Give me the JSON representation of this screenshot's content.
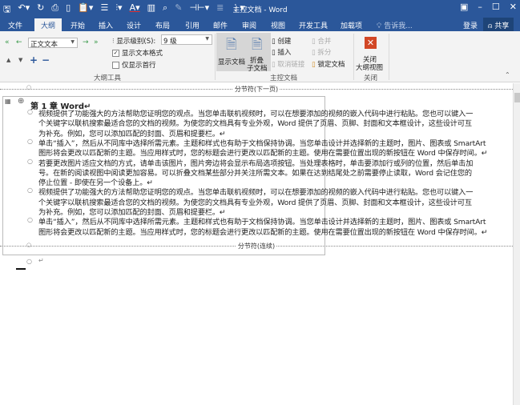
{
  "window": {
    "title": "主控文档 - Word",
    "qat_icons": [
      "save-icon",
      "undo-icon",
      "redo-icon",
      "print-preview-icon",
      "new-icon",
      "paste-icon",
      "outline-icon",
      "align-icon",
      "font-color-icon",
      "columns-icon",
      "find-icon",
      "pen-icon",
      "margins-icon",
      "list-icon",
      "more-icon"
    ]
  },
  "tabs": [
    {
      "label": "文件"
    },
    {
      "label": "大纲"
    },
    {
      "label": "开始"
    },
    {
      "label": "插入"
    },
    {
      "label": "设计"
    },
    {
      "label": "布局"
    },
    {
      "label": "引用"
    },
    {
      "label": "邮件"
    },
    {
      "label": "审阅"
    },
    {
      "label": "视图"
    },
    {
      "label": "开发工具"
    },
    {
      "label": "加载项"
    }
  ],
  "tell_me": "告诉我...",
  "login": "登录",
  "share": "共享",
  "outline_tools": {
    "level_value": "正文文本",
    "show_level_label": "显示级别(S):",
    "show_level_value": "9 级",
    "show_format": "显示文本格式",
    "first_line_only": "仅显示首行",
    "group_label": "大纲工具",
    "show_format_checked": true,
    "first_line_checked": false
  },
  "master_doc": {
    "show_doc": "显示文档",
    "collapse_line1": "折叠",
    "collapse_line2": "子文档",
    "create": "创建",
    "insert": "插入",
    "unlink": "取消链接",
    "merge": "合并",
    "split": "拆分",
    "lock": "锁定文档",
    "group_label": "主控文档"
  },
  "close": {
    "line1": "关闭",
    "line2": "大纲视图",
    "group_label": "关闭"
  },
  "document": {
    "break_top": "分节符(下一页)",
    "break_bottom": "分节符(连续)",
    "heading": "第 1 章 Word↵",
    "paragraphs": [
      [
        "视频提供了功能强大的方法帮助您证明您的观点。当您单击联机视频时，可以在想要添加的视频的嵌入代码中进行粘贴。您也可以键入一",
        "个关键字以联机搜索最适合您的文档的视频。为使您的文档具有专业外观，Word 提供了页眉、页脚、封面和文本框设计，这些设计可互",
        "为补充。例如，您可以添加匹配的封面、页眉和提要栏。↵"
      ],
      [
        "单击“插入”，然后从不同库中选择所需元素。主题和样式也有助于文档保持协调。当您单击设计并选择新的主题时，图片、图表或 SmartArt",
        "图形将会更改以匹配新的主题。当应用样式时，您的标题会进行更改以匹配新的主题。使用在需要位置出现的新按钮在 Word 中保存时间。↵"
      ],
      [
        "若要更改图片适应文档的方式，请单击该图片，图片旁边将会显示布局选项按钮。当处理表格时，单击要添加行或列的位置，然后单击加",
        "号。在新的阅读视图中阅读更加容易。可以折叠文档某些部分并关注所需文本。如果在达到结尾处之前需要停止读取，Word 会记住您的",
        "停止位置 - 即使在另一个设备上。↵"
      ],
      [
        "视频提供了功能强大的方法帮助您证明您的观点。当您单击联机视频时，可以在想要添加的视频的嵌入代码中进行粘贴。您也可以键入一",
        "个关键字以联机搜索最适合您的文档的视频。为使您的文档具有专业外观，Word 提供了页眉、页脚、封面和文本框设计，这些设计可互",
        "为补充。例如，您可以添加匹配的封面、页眉和提要栏。↵"
      ],
      [
        "单击“插入”，然后从不同库中选择所需元素。主题和样式也有助于文档保持协调。当您单击设计并选择新的主题时，图片、图表或 SmartArt",
        "图形将会更改以匹配新的主题。当应用样式时，您的标题会进行更改以匹配新的主题。使用在需要位置出现的新按钮在 Word 中保存时间。↵"
      ]
    ],
    "empty_para": "↵"
  }
}
